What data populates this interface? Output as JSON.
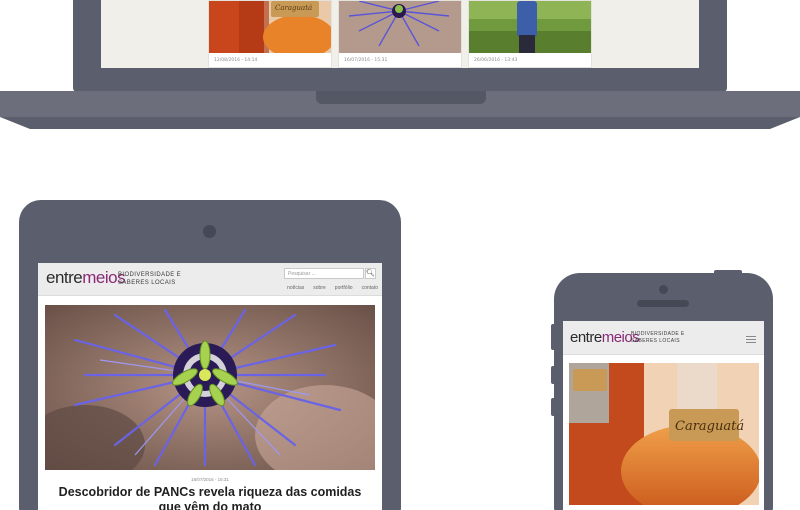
{
  "laptop": {
    "cards": [
      {
        "thumb": "bottle-photo",
        "date": "12/08/2016 - 14:14"
      },
      {
        "thumb": "flower-photo",
        "date": "16/07/2016 - 15:31"
      },
      {
        "thumb": "farmer-photo",
        "date": "26/06/2016 - 13:43"
      }
    ]
  },
  "tablet": {
    "logo_part1": "entre",
    "logo_part2": "meios",
    "tagline_line1": "Biodiversidade e",
    "tagline_line2": "Saberes Locais",
    "search_placeholder": "Pesquisar ...",
    "nav": [
      "notícias",
      "sobre",
      "portfólio",
      "contato"
    ],
    "article_date": "16/07/2016 - 15:31",
    "article_title": "Descobridor de PANCs revela riqueza das comidas que vêm do mato"
  },
  "phone": {
    "logo_part1": "entre",
    "logo_part2": "meios",
    "tagline_line1": "Biodiversidade e",
    "tagline_line2": "Saberes Locais",
    "bottle_label": "Caraguatá"
  },
  "colors": {
    "device_frame": "#5b5f6d",
    "logo_accent": "#8a2a76",
    "header_bg": "#ececec"
  }
}
